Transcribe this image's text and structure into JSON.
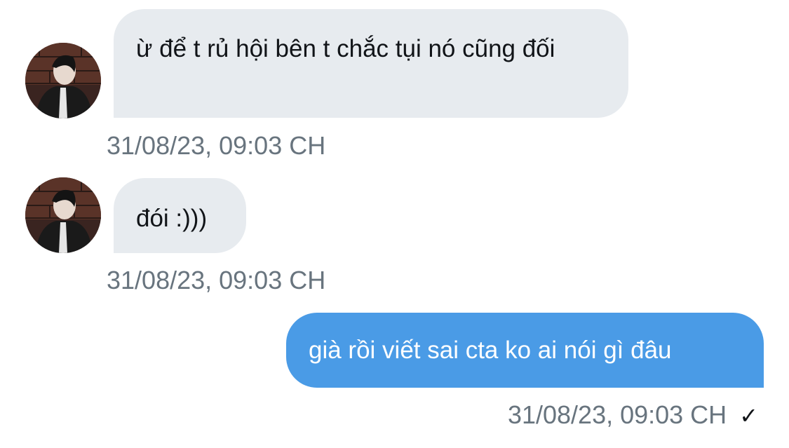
{
  "messages": [
    {
      "direction": "incoming",
      "text": "ừ để t rủ hội bên t chắc tụi nó cũng đối",
      "timestamp": "31/08/23, 09:03 CH"
    },
    {
      "direction": "incoming",
      "text": "đói :)))",
      "timestamp": "31/08/23, 09:03 CH"
    },
    {
      "direction": "outgoing",
      "text": "già rồi viết sai cta ko ai nói gì đâu",
      "timestamp": "31/08/23, 09:03 CH",
      "status_icon": "checkmark-icon",
      "status_glyph": "✓"
    }
  ],
  "colors": {
    "incoming_bubble": "#e7ebef",
    "outgoing_bubble": "#4a9be6",
    "timestamp_text": "#68747e",
    "message_text": "#111418"
  }
}
